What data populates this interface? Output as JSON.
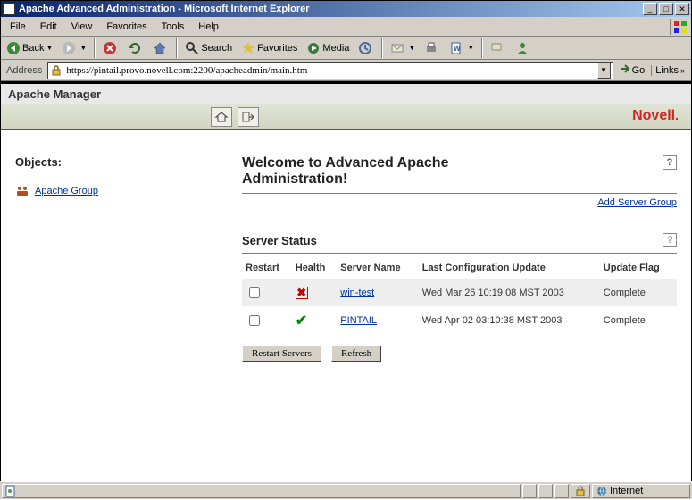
{
  "window": {
    "title": "Apache Advanced Administration - Microsoft Internet Explorer"
  },
  "menubar": {
    "file": "File",
    "edit": "Edit",
    "view": "View",
    "favorites": "Favorites",
    "tools": "Tools",
    "help": "Help"
  },
  "toolbar": {
    "back": "Back",
    "search": "Search",
    "favorites": "Favorites",
    "media": "Media"
  },
  "address": {
    "label": "Address",
    "value": "https://pintail.provo.novell.com:2200/apacheadmin/main.htm",
    "go": "Go",
    "links": "Links"
  },
  "app": {
    "manager_title": "Apache Manager",
    "brand": "Novell"
  },
  "left": {
    "objects_label": "Objects:",
    "tree_item": "Apache Group"
  },
  "main": {
    "welcome": "Welcome to Advanced Apache Administration!",
    "add_server_group": "Add Server Group",
    "server_status": "Server Status",
    "columns": {
      "restart": "Restart",
      "health": "Health",
      "server_name": "Server Name",
      "last_update": "Last Configuration Update",
      "update_flag": "Update Flag"
    },
    "rows": [
      {
        "server": "win-test",
        "last_update": "Wed Mar 26 10:19:08 MST 2003",
        "flag": "Complete",
        "health": "bad"
      },
      {
        "server": "PINTAIL",
        "last_update": "Wed Apr 02 03:10:38 MST 2003",
        "flag": "Complete",
        "health": "good"
      }
    ],
    "restart_btn": "Restart Servers",
    "refresh_btn": "Refresh"
  },
  "statusbar": {
    "zone": "Internet"
  }
}
